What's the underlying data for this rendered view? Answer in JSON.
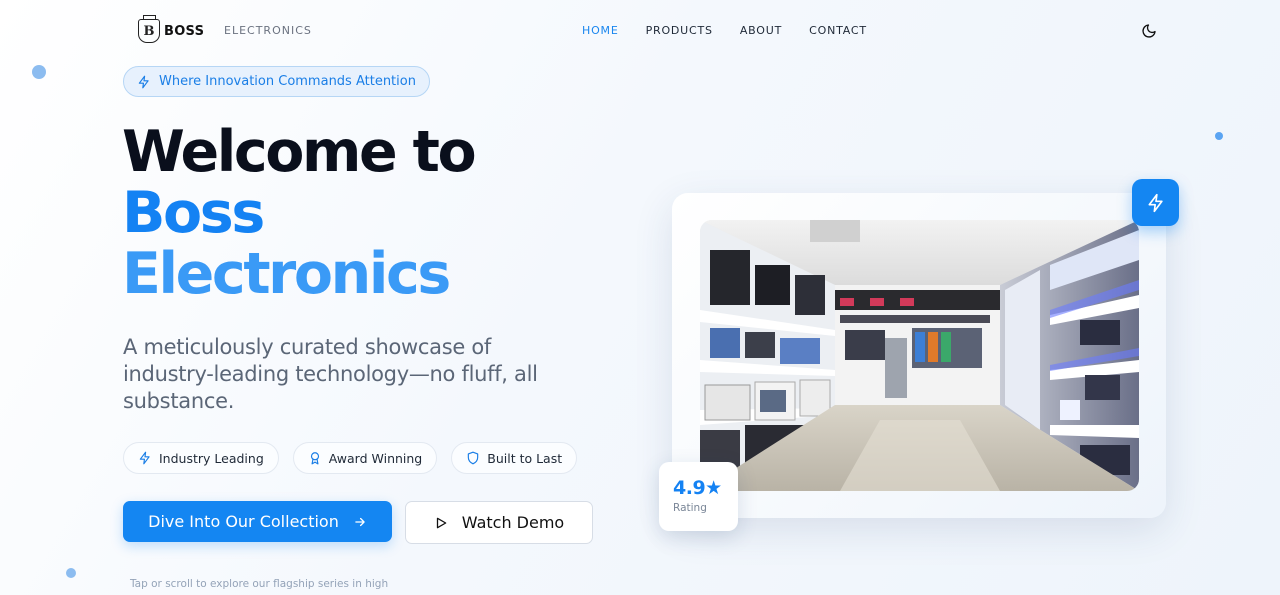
{
  "header": {
    "brand_mark": "B",
    "brand": "BOSS",
    "brand_sub": "ELECTRONICS",
    "nav": [
      {
        "label": "HOME",
        "active": true
      },
      {
        "label": "PRODUCTS",
        "active": false
      },
      {
        "label": "ABOUT",
        "active": false
      },
      {
        "label": "CONTACT",
        "active": false
      }
    ],
    "theme_icon": "moon-icon"
  },
  "hero": {
    "tagline": "Where Innovation Commands Attention",
    "title_line1": "Welcome to",
    "title_line2": "Boss",
    "title_line3": "Electronics",
    "description": "A meticulously curated showcase of industry-leading technology—no fluff, all substance.",
    "features": [
      {
        "label": "Industry Leading",
        "icon": "bolt-icon"
      },
      {
        "label": "Award Winning",
        "icon": "award-icon"
      },
      {
        "label": "Built to Last",
        "icon": "shield-icon"
      }
    ],
    "primary_cta": "Dive Into Our Collection",
    "secondary_cta": "Watch Demo",
    "hint": "Tap or scroll to explore our flagship series in high"
  },
  "showcase": {
    "rating_value": "4.9★",
    "rating_label": "Rating"
  },
  "colors": {
    "accent": "#1486f2",
    "accent_light": "#3a9af6",
    "heading": "#0a0f1c",
    "body_text": "#5b6677"
  }
}
